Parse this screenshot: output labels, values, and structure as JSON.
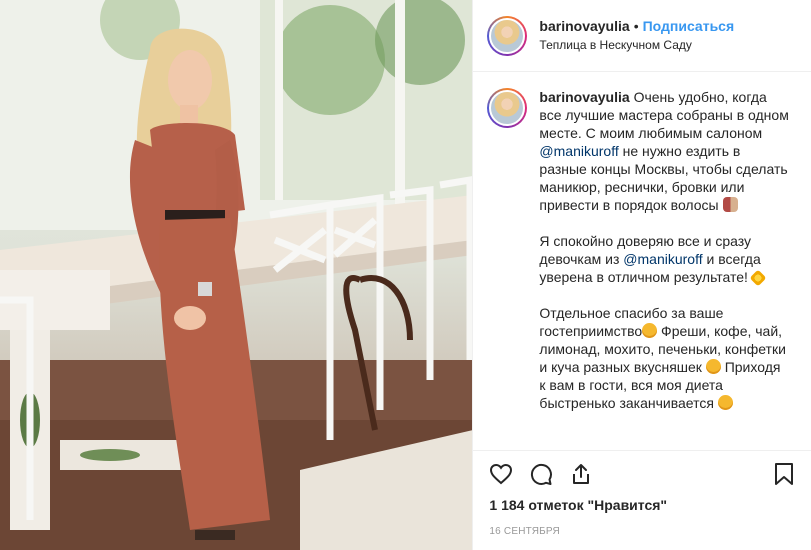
{
  "header": {
    "username": "barinovayulia",
    "separator": "•",
    "follow_label": "Подписаться",
    "location": "Теплица в Нескучном Саду"
  },
  "caption": {
    "username": "barinovayulia",
    "p1_a": " Очень удобно, когда все лучшие мастера собраны в одном месте. С моим любимым салоном ",
    "mention1": "@manikuroff",
    "p1_b": " не нужно ездить в разные концы Москвы, чтобы сделать маникюр, реснички, бровки или привести в порядок волосы ",
    "p2_a": "Я спокойно доверяю все и сразу девочкам из ",
    "mention2": "@manikuroff",
    "p2_b": " и всегда уверена в отличном результате! ",
    "p3_a": "Отдельное спасибо за ваше гостеприимство",
    "p3_b": " Фреши, кофе, чай, лимонад, мохито, печеньки, конфетки и куча разных вкусняшек ",
    "p3_c": " Приходя к вам в гости, вся моя диета быстренько заканчивается "
  },
  "icons": [
    "heart-icon",
    "comment-icon",
    "share-icon",
    "bookmark-icon"
  ],
  "likes_text": "1 184 отметок \"Нравится\"",
  "date_text": "16 сентября",
  "colors": {
    "accent": "#3897f0",
    "mention": "#003569",
    "text": "#262626",
    "muted": "#999999"
  }
}
